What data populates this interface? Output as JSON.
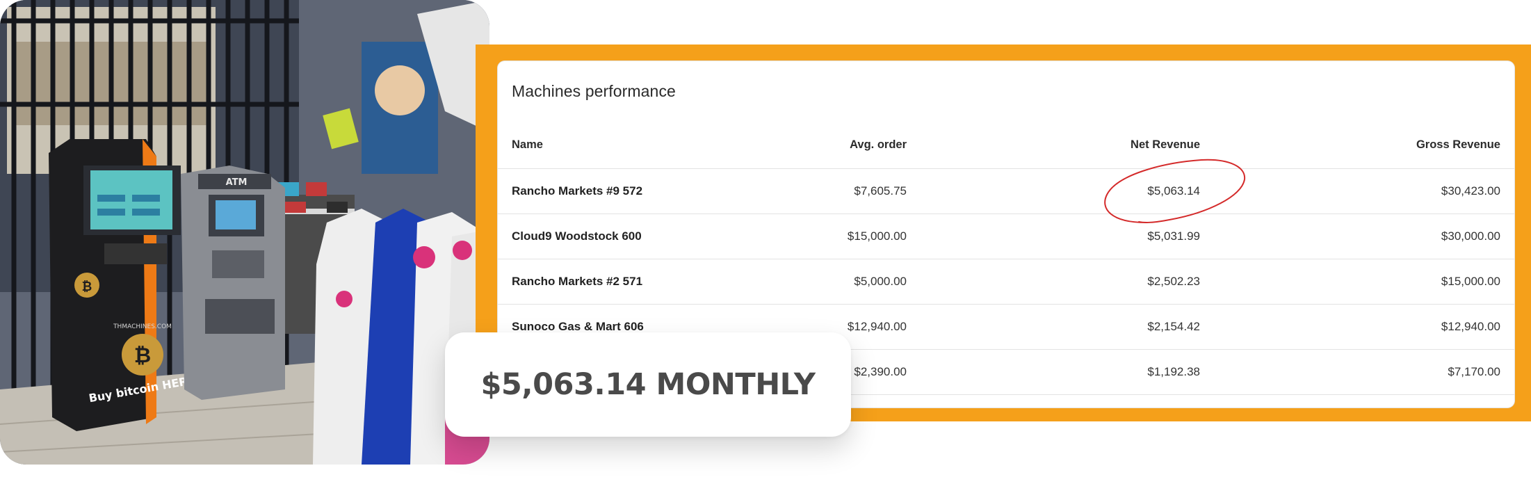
{
  "photo": {
    "machine_brand": "THMACHINES.COM",
    "machine_slogan": "Buy bitcoin HERE",
    "atm_sign": "ATM"
  },
  "table": {
    "title": "Machines performance",
    "columns": [
      "Name",
      "Avg. order",
      "Net Revenue",
      "Gross Revenue"
    ],
    "rows": [
      {
        "name": "Rancho Markets #9 572",
        "avg": "$7,605.75",
        "net": "$5,063.14",
        "gross": "$30,423.00"
      },
      {
        "name": "Cloud9 Woodstock 600",
        "avg": "$15,000.00",
        "net": "$5,031.99",
        "gross": "$30,000.00"
      },
      {
        "name": "Rancho Markets #2 571",
        "avg": "$5,000.00",
        "net": "$2,502.23",
        "gross": "$15,000.00"
      },
      {
        "name": "Sunoco Gas & Mart 606",
        "avg": "$12,940.00",
        "net": "$2,154.42",
        "gross": "$12,940.00"
      },
      {
        "name": "",
        "avg": "$2,390.00",
        "net": "$1,192.38",
        "gross": "$7,170.00"
      }
    ]
  },
  "highlight": {
    "circled_value": "$5,063.14",
    "circle_color": "#d42a2a"
  },
  "callout": {
    "text": "$5,063.14 MONTHLY"
  },
  "colors": {
    "frame": "#f5a01a",
    "callout_text": "#4a4a4a"
  }
}
